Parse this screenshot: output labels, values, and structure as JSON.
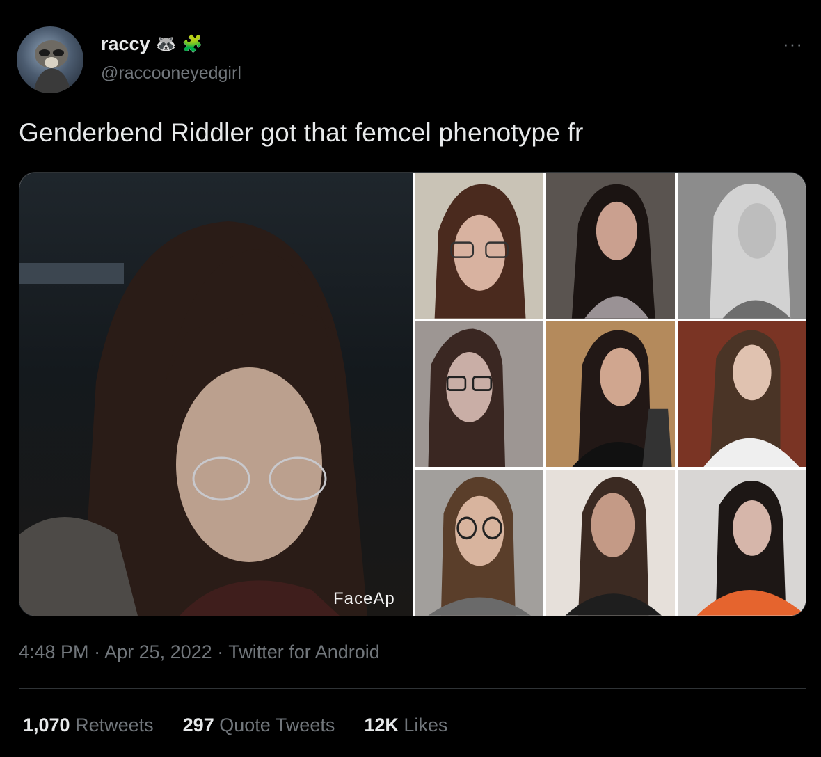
{
  "author": {
    "display_name": "raccy",
    "badges": [
      "🦝",
      "🧩"
    ],
    "handle": "@raccooneyedgirl"
  },
  "more_icon": "···",
  "tweet": {
    "text": "Genderbend Riddler got that femcel phenotype fr"
  },
  "media": {
    "watermark": "FaceAp"
  },
  "meta": {
    "time": "4:48 PM",
    "sep1": " · ",
    "date": "Apr 25, 2022",
    "sep2": " · ",
    "source": "Twitter for Android"
  },
  "stats": [
    {
      "count": "1,070",
      "label": "Retweets"
    },
    {
      "count": "297",
      "label": "Quote Tweets"
    },
    {
      "count": "12K",
      "label": "Likes"
    }
  ],
  "colors": {
    "background": "#000000",
    "text_primary": "#e7e9ea",
    "text_secondary": "#71767b",
    "divider": "#2f3336"
  }
}
